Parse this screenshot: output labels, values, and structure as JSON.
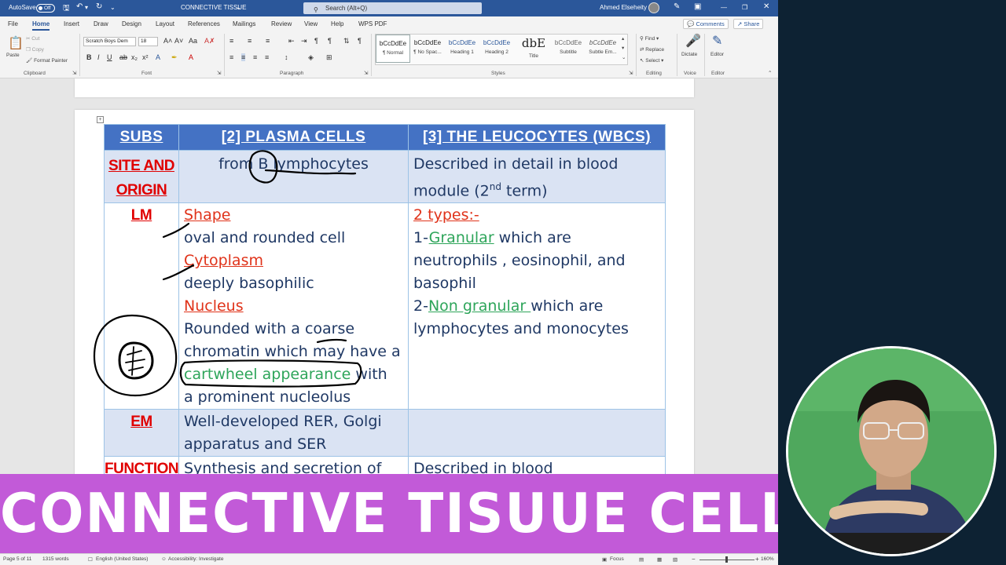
{
  "titlebar": {
    "autosave_label": "AutoSave",
    "autosave_state": "Off",
    "doc_title": "CONNECTIVE TISSUE",
    "search_placeholder": "Search (Alt+Q)",
    "user_name": "Ahmed Elseheity"
  },
  "ribbon_tabs": [
    "File",
    "Home",
    "Insert",
    "Draw",
    "Design",
    "Layout",
    "References",
    "Mailings",
    "Review",
    "View",
    "Help",
    "WPS PDF"
  ],
  "ribbon_actions": {
    "comments": "Comments",
    "share": "Share"
  },
  "clipboard": {
    "paste": "Paste",
    "cut": "Cut",
    "copy": "Copy",
    "format_painter": "Format Painter",
    "label": "Clipboard"
  },
  "font": {
    "family": "Scratch Boys Dem",
    "size": "18",
    "label": "Font"
  },
  "paragraph": {
    "label": "Paragraph"
  },
  "styles": {
    "label": "Styles",
    "items": [
      {
        "preview": "bCcDdEe",
        "name": "¶ Normal"
      },
      {
        "preview": "bCcDdEe",
        "name": "¶ No Spac..."
      },
      {
        "preview": "bCcDdEe",
        "name": "Heading 1"
      },
      {
        "preview": "bCcDdEe",
        "name": "Heading 2"
      },
      {
        "preview": "dbE",
        "name": "Title"
      },
      {
        "preview": "bCcDdEe",
        "name": "Subtitle"
      },
      {
        "preview": "bCcDdEe",
        "name": "Subtle Em..."
      }
    ]
  },
  "editing": {
    "find": "Find",
    "replace": "Replace",
    "select": "Select",
    "label": "Editing"
  },
  "voice": {
    "dictate": "Dictate",
    "label": "Voice"
  },
  "editor": {
    "name": "Editor",
    "label": "Editor"
  },
  "table": {
    "headers": [
      "SUBS",
      "[2] PLASMA CELLS",
      "[3] THE LEUCOCYTES (WBCS)"
    ],
    "site": {
      "sub": [
        "SITE AND",
        "ORIGIN"
      ],
      "plasma": "from B lymphocytes",
      "leuco_1": "Described in detail in blood",
      "leuco_2a": "module (2",
      "leuco_sup": "nd",
      "leuco_2b": " term)"
    },
    "lm": {
      "sub": "LM",
      "shape": "Shape",
      "shape_desc": "oval and rounded cell",
      "cytoplasm": "Cytoplasm",
      "cytoplasm_desc": "deeply basophilic",
      "nucleus": "Nucleus",
      "nucleus_1": "Rounded with a coarse",
      "nucleus_2": "chromatin which may have a",
      "nucleus_3_hl": "cartwheel appearance",
      "nucleus_3_rest": " with",
      "nucleus_4": "a prominent nucleolus",
      "types": "2 types:-",
      "granular_pre": "1-",
      "granular": "Granular",
      "granular_rest": " which are",
      "granular_2": "neutrophils , eosinophil, and",
      "granular_3": "basophil",
      "nongranular_pre": "2-",
      "nongranular": "Non granular ",
      "nongranular_rest": "which are",
      "nongranular_2": "lymphocytes and monocytes"
    },
    "em": {
      "sub": "EM",
      "plasma_1": "Well-developed RER, Golgi",
      "plasma_2": "apparatus and SER"
    },
    "function": {
      "sub": "FUNCTION",
      "plasma": "Synthesis and secretion of",
      "leuco": "Described in blood"
    }
  },
  "banner": "CONNECTIVE TISUUE CELLS",
  "statusbar": {
    "page": "Page 5 of 11",
    "words": "1315 words",
    "language": "English (United States)",
    "accessibility": "Accessibility: Investigate",
    "focus": "Focus",
    "zoom": "160%"
  }
}
